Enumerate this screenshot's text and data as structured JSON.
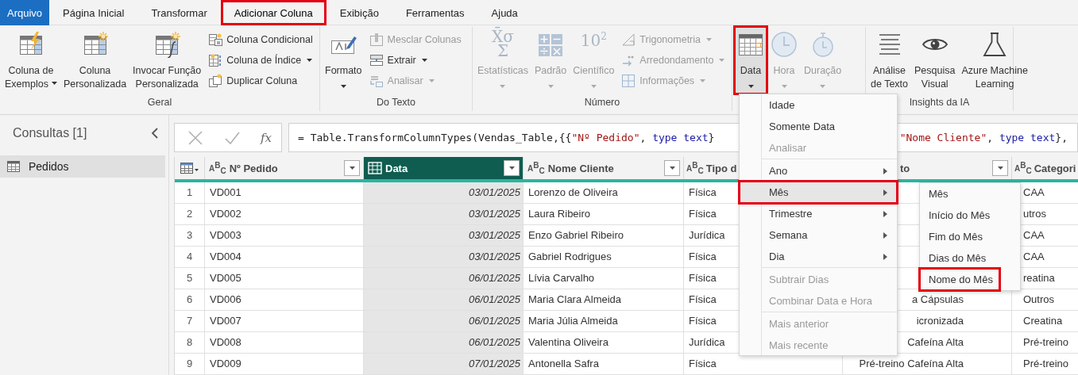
{
  "tabs": [
    {
      "label": "Arquivo",
      "kind": "file",
      "selected": false,
      "annotated": false
    },
    {
      "label": "Página Inicial",
      "kind": "tab",
      "selected": false,
      "annotated": false
    },
    {
      "label": "Transformar",
      "kind": "tab",
      "selected": false,
      "annotated": false
    },
    {
      "label": "Adicionar Coluna",
      "kind": "tab",
      "selected": true,
      "annotated": true
    },
    {
      "label": "Exibição",
      "kind": "tab",
      "selected": false,
      "annotated": false
    },
    {
      "label": "Ferramentas",
      "kind": "tab",
      "selected": false,
      "annotated": false
    },
    {
      "label": "Ajuda",
      "kind": "tab",
      "selected": false,
      "annotated": false
    }
  ],
  "ribbon": {
    "groups": [
      {
        "label": "Geral",
        "items": [
          {
            "kind": "large",
            "label": "Coluna de\nExemplos",
            "dropdown": true,
            "disabled": false
          },
          {
            "kind": "large",
            "label": "Coluna\nPersonalizada",
            "dropdown": false,
            "disabled": false
          },
          {
            "kind": "large",
            "label": "Invocar Função\nPersonalizada",
            "dropdown": false,
            "disabled": false
          },
          {
            "kind": "small",
            "label": "Coluna Condicional",
            "dropdown": false,
            "disabled": false
          },
          {
            "kind": "small",
            "label": "Coluna de Índice",
            "dropdown": true,
            "disabled": false
          },
          {
            "kind": "small",
            "label": "Duplicar Coluna",
            "dropdown": false,
            "disabled": false
          }
        ]
      },
      {
        "label": "Do Texto",
        "items": [
          {
            "kind": "large",
            "label": "Formato",
            "dropdown": true,
            "disabled": false
          },
          {
            "kind": "small",
            "label": "Mesclar Colunas",
            "dropdown": false,
            "disabled": true
          },
          {
            "kind": "small",
            "label": "Extrair",
            "dropdown": true,
            "disabled": false
          },
          {
            "kind": "small",
            "label": "Analisar",
            "dropdown": true,
            "disabled": true
          }
        ]
      },
      {
        "label": "Número",
        "items": [
          {
            "kind": "large",
            "label": "Estatísticas",
            "dropdown": true,
            "disabled": true,
            "glyph": "X̄σ\nΣ"
          },
          {
            "kind": "large",
            "label": "Padrão",
            "dropdown": true,
            "disabled": true
          },
          {
            "kind": "large",
            "label": "Científico",
            "dropdown": true,
            "disabled": true,
            "glyph": "10$^{2}$"
          },
          {
            "kind": "small",
            "label": "Trigonometria",
            "dropdown": true,
            "disabled": true
          },
          {
            "kind": "small",
            "label": "Arredondamento",
            "dropdown": true,
            "disabled": true
          },
          {
            "kind": "small",
            "label": "Informações",
            "dropdown": true,
            "disabled": true
          }
        ]
      },
      {
        "items": [
          {
            "kind": "large",
            "label": "Data",
            "dropdown": true,
            "disabled": false,
            "pressed": true,
            "annotated": true
          },
          {
            "kind": "large",
            "label": "Hora",
            "dropdown": true,
            "disabled": true,
            "pressed": false,
            "annotated": false
          },
          {
            "kind": "large",
            "label": "Duração",
            "dropdown": true,
            "disabled": true,
            "pressed": false,
            "annotated": false
          }
        ]
      },
      {
        "label": "Insights da IA",
        "items": [
          {
            "kind": "large",
            "label": "Análise\nde Texto",
            "dropdown": false,
            "disabled": false
          },
          {
            "kind": "large",
            "label": "Pesquisa\nVisual",
            "dropdown": false,
            "disabled": false
          },
          {
            "kind": "large",
            "label": "Azure Machine\nLearning",
            "dropdown": false,
            "disabled": false
          }
        ]
      }
    ]
  },
  "queries": {
    "title": "Consultas [1]",
    "items": [
      {
        "label": "Pedidos",
        "selected": true
      }
    ]
  },
  "formula_bar": {
    "function_label": "fx",
    "parts": [
      [
        {
          "kind": "plain",
          "text": "= Table.TransformColumnTypes(Vendas_Table,{{"
        },
        {
          "kind": "string",
          "text": "\"Nº Pedido\""
        },
        {
          "kind": "plain",
          "text": ", "
        },
        {
          "kind": "keyword",
          "text": "type text"
        },
        {
          "kind": "plain",
          "text": "}"
        }
      ],
      [
        {
          "kind": "string",
          "text": "\"Nome Cliente\""
        },
        {
          "kind": "plain",
          "text": ", "
        },
        {
          "kind": "keyword",
          "text": "type text"
        },
        {
          "kind": "plain",
          "text": "},"
        }
      ]
    ]
  },
  "table": {
    "columns": [
      {
        "kind": "text",
        "type_label": "A$^{B}$$_{C}$",
        "label": "Nº Pedido",
        "selected": false,
        "filter": true
      },
      {
        "kind": "date",
        "label": "Data",
        "selected": true,
        "filter": true
      },
      {
        "kind": "text",
        "type_label": "A$^{B}$$_{C}$",
        "label": "Nome Cliente",
        "selected": false,
        "filter": true
      },
      {
        "kind": "text",
        "type_label": "A$^{B}$$_{C}$",
        "label": "Tipo d",
        "selected": false
      },
      {
        "kind": "text",
        "label": "to",
        "selected": false,
        "filter": true
      },
      {
        "kind": "text",
        "type_label": "A$^{B}$$_{C}$",
        "label": "Categori",
        "selected": false
      }
    ],
    "rows": [
      {
        "number": "1",
        "cells": [
          "VD001",
          "03/01/2025",
          "Lorenzo de Oliveira",
          "Física",
          null,
          "CAA"
        ]
      },
      {
        "number": "2",
        "cells": [
          "VD002",
          "03/01/2025",
          "Laura Ribeiro",
          "Física",
          null,
          "utros"
        ]
      },
      {
        "number": "3",
        "cells": [
          "VD003",
          "03/01/2025",
          "Enzo Gabriel Ribeiro",
          "Jurídica",
          null,
          "CAA"
        ]
      },
      {
        "number": "4",
        "cells": [
          "VD004",
          "03/01/2025",
          "Gabriel Rodrigues",
          "Física",
          null,
          "CAA"
        ]
      },
      {
        "number": "5",
        "cells": [
          "VD005",
          "06/01/2025",
          "Lívia Carvalho",
          "Física",
          null,
          "reatina"
        ]
      },
      {
        "number": "6",
        "cells": [
          "VD006",
          "06/01/2025",
          "Maria Clara Almeida",
          "Física",
          "a Cápsulas",
          "Outros"
        ]
      },
      {
        "number": "7",
        "cells": [
          "VD007",
          "06/01/2025",
          "Maria Júlia Almeida",
          "Física",
          "icronizada",
          "Creatina"
        ]
      },
      {
        "number": "8",
        "cells": [
          "VD008",
          "06/01/2025",
          "Valentina Oliveira",
          "Jurídica",
          "Cafeína Alta",
          "Pré-treino"
        ]
      },
      {
        "number": "9",
        "cells": [
          "VD009",
          "07/01/2025",
          "Antonella Safra",
          "Física",
          "Pré-treino Cafeína Alta",
          "Pré-treino"
        ]
      }
    ]
  },
  "date_menu": {
    "items": [
      {
        "label": "Idade",
        "disabled": false,
        "has_submenu": false,
        "separator_before": false,
        "selected": false,
        "annotated": false
      },
      {
        "label": "Somente Data",
        "disabled": false,
        "has_submenu": false,
        "separator_before": false,
        "selected": false,
        "annotated": false
      },
      {
        "label": "Analisar",
        "disabled": true,
        "has_submenu": false,
        "separator_before": false,
        "selected": false,
        "annotated": false
      },
      {
        "label": "Ano",
        "disabled": false,
        "has_submenu": true,
        "separator_before": true,
        "selected": false,
        "annotated": false
      },
      {
        "label": "Mês",
        "disabled": false,
        "has_submenu": true,
        "separator_before": false,
        "selected": true,
        "annotated": true
      },
      {
        "label": "Trimestre",
        "disabled": false,
        "has_submenu": true,
        "separator_before": false,
        "selected": false,
        "annotated": false
      },
      {
        "label": "Semana",
        "disabled": false,
        "has_submenu": true,
        "separator_before": false,
        "selected": false,
        "annotated": false
      },
      {
        "label": "Dia",
        "disabled": false,
        "has_submenu": true,
        "separator_before": false,
        "selected": false,
        "annotated": false
      },
      {
        "label": "Subtrair Dias",
        "disabled": true,
        "has_submenu": false,
        "separator_before": true,
        "selected": false,
        "annotated": false
      },
      {
        "label": "Combinar Data e Hora",
        "disabled": true,
        "has_submenu": false,
        "separator_before": false,
        "selected": false,
        "annotated": false
      },
      {
        "label": "Mais anterior",
        "disabled": true,
        "has_submenu": false,
        "separator_before": true,
        "selected": false,
        "annotated": false
      },
      {
        "label": "Mais recente",
        "disabled": true,
        "has_submenu": false,
        "separator_before": false,
        "selected": false,
        "annotated": false
      }
    ]
  },
  "month_submenu": {
    "items": [
      {
        "label": "Mês",
        "annotated": false
      },
      {
        "label": "Início do Mês",
        "annotated": false
      },
      {
        "label": "Fim do Mês",
        "annotated": false
      },
      {
        "label": "Dias do Mês",
        "annotated": false
      },
      {
        "label": "Nome do Mês",
        "annotated": true
      }
    ]
  }
}
